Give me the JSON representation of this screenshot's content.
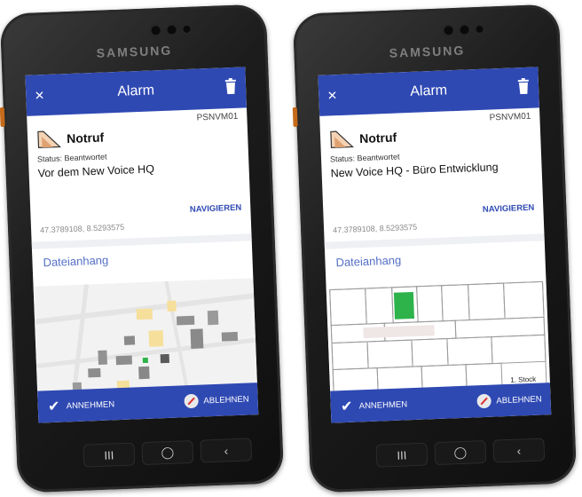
{
  "brand": "SAMSUNG",
  "phones": [
    {
      "app_title": "Alarm",
      "close_glyph": "×",
      "code": "PSNVM01",
      "alert_title": "Notruf",
      "status": "Status: Beantwortet",
      "location": "Vor dem New Voice HQ",
      "coords": "47.3789108, 8.5293575",
      "navigate": "NAVIGIEREN",
      "attachment_label": "Dateianhang",
      "attachment_kind": "map",
      "accept": "ANNEHMEN",
      "decline": "ABLEHNEN"
    },
    {
      "app_title": "Alarm",
      "close_glyph": "×",
      "code": "PSNVM01",
      "alert_title": "Notruf",
      "status": "Status: Beantwortet",
      "location": "New Voice HQ - Büro Entwicklung",
      "coords": "47.3789108, 8.5293575",
      "navigate": "NAVIGIEREN",
      "attachment_label": "Dateianhang",
      "attachment_kind": "floorplan",
      "floor_label": "1. Stock",
      "accept": "ANNEHMEN",
      "decline": "ABLEHNEN"
    }
  ],
  "nav_keys": {
    "recent": "III",
    "home": "◯",
    "back": "‹"
  },
  "icons": {
    "alarm": "alarm-hand-icon",
    "trash": "trash-icon",
    "close": "close-icon",
    "accept": "checkmark-icon",
    "decline": "decline-icon"
  },
  "colors": {
    "primary": "#2f49b3",
    "link": "#2f49b3",
    "label": "#5470c6",
    "highlight_room": "#2db34a"
  }
}
